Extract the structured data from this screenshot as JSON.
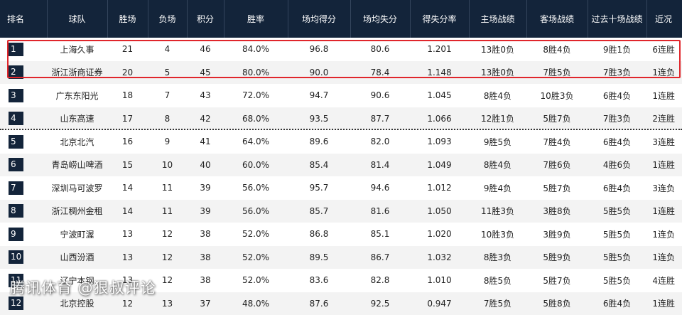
{
  "header": [
    "排名",
    "球队",
    "胜场",
    "负场",
    "积分",
    "胜率",
    "场均得分",
    "场均失分",
    "得失分率",
    "主场战绩",
    "客场战绩",
    "过去十场战绩",
    "近况"
  ],
  "rows": [
    {
      "rank": "1",
      "team": "上海久事",
      "wins": "21",
      "losses": "4",
      "points": "46",
      "win_pct": "84.0%",
      "ppg": "96.8",
      "opp_ppg": "80.6",
      "ratio": "1.201",
      "home": "13胜0负",
      "away": "8胜4负",
      "last10": "9胜1负",
      "streak": "6连胜"
    },
    {
      "rank": "2",
      "team": "浙江浙商证券",
      "wins": "20",
      "losses": "5",
      "points": "45",
      "win_pct": "80.0%",
      "ppg": "90.0",
      "opp_ppg": "78.4",
      "ratio": "1.148",
      "home": "13胜0负",
      "away": "7胜5负",
      "last10": "7胜3负",
      "streak": "1连负"
    },
    {
      "rank": "3",
      "team": "广东东阳光",
      "wins": "18",
      "losses": "7",
      "points": "43",
      "win_pct": "72.0%",
      "ppg": "94.7",
      "opp_ppg": "90.6",
      "ratio": "1.045",
      "home": "8胜4负",
      "away": "10胜3负",
      "last10": "6胜4负",
      "streak": "1连胜"
    },
    {
      "rank": "4",
      "team": "山东高速",
      "wins": "17",
      "losses": "8",
      "points": "42",
      "win_pct": "68.0%",
      "ppg": "93.5",
      "opp_ppg": "87.7",
      "ratio": "1.066",
      "home": "12胜1负",
      "away": "5胜7负",
      "last10": "7胜3负",
      "streak": "2连胜"
    },
    {
      "rank": "5",
      "team": "北京北汽",
      "wins": "16",
      "losses": "9",
      "points": "41",
      "win_pct": "64.0%",
      "ppg": "89.6",
      "opp_ppg": "82.0",
      "ratio": "1.093",
      "home": "9胜5负",
      "away": "7胜4负",
      "last10": "6胜4负",
      "streak": "3连胜"
    },
    {
      "rank": "6",
      "team": "青岛崂山啤酒",
      "wins": "15",
      "losses": "10",
      "points": "40",
      "win_pct": "60.0%",
      "ppg": "85.4",
      "opp_ppg": "81.4",
      "ratio": "1.049",
      "home": "8胜4负",
      "away": "7胜6负",
      "last10": "4胜6负",
      "streak": "1连胜"
    },
    {
      "rank": "7",
      "team": "深圳马可波罗",
      "wins": "14",
      "losses": "11",
      "points": "39",
      "win_pct": "56.0%",
      "ppg": "95.7",
      "opp_ppg": "94.6",
      "ratio": "1.012",
      "home": "9胜4负",
      "away": "5胜7负",
      "last10": "6胜4负",
      "streak": "3连负"
    },
    {
      "rank": "8",
      "team": "浙江稠州金租",
      "wins": "14",
      "losses": "11",
      "points": "39",
      "win_pct": "56.0%",
      "ppg": "85.7",
      "opp_ppg": "81.6",
      "ratio": "1.050",
      "home": "11胜3负",
      "away": "3胜8负",
      "last10": "5胜5负",
      "streak": "1连胜"
    },
    {
      "rank": "9",
      "team": "宁波町渥",
      "wins": "13",
      "losses": "12",
      "points": "38",
      "win_pct": "52.0%",
      "ppg": "86.8",
      "opp_ppg": "85.1",
      "ratio": "1.020",
      "home": "10胜3负",
      "away": "3胜9负",
      "last10": "5胜5负",
      "streak": "1连负"
    },
    {
      "rank": "10",
      "team": "山西汾酒",
      "wins": "13",
      "losses": "12",
      "points": "38",
      "win_pct": "52.0%",
      "ppg": "89.5",
      "opp_ppg": "86.7",
      "ratio": "1.032",
      "home": "8胜3负",
      "away": "5胜9负",
      "last10": "5胜5负",
      "streak": "1连负"
    },
    {
      "rank": "11",
      "team": "辽宁本钢",
      "wins": "13",
      "losses": "12",
      "points": "38",
      "win_pct": "52.0%",
      "ppg": "83.6",
      "opp_ppg": "82.8",
      "ratio": "1.010",
      "home": "8胜5负",
      "away": "5胜7负",
      "last10": "5胜5负",
      "streak": "4连胜"
    },
    {
      "rank": "12",
      "team": "北京控股",
      "wins": "12",
      "losses": "13",
      "points": "37",
      "win_pct": "48.0%",
      "ppg": "87.6",
      "opp_ppg": "92.5",
      "ratio": "0.947",
      "home": "7胜5负",
      "away": "5胜8负",
      "last10": "6胜4负",
      "streak": "1连胜"
    }
  ],
  "watermark": "腾讯体育 @狠叔评论",
  "colors": {
    "header_bg": "#13243a",
    "highlight": "#e0262b",
    "row_alt": "#f3f3f3"
  }
}
